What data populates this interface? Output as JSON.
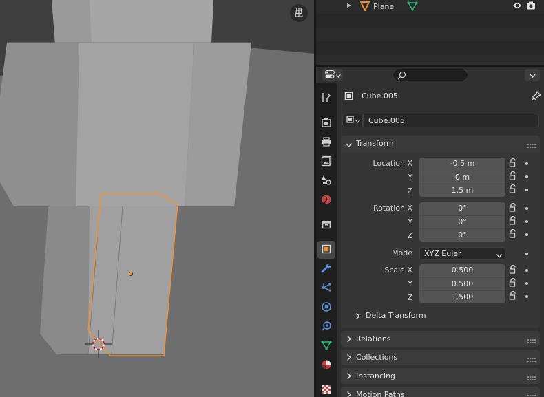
{
  "viewport": {
    "toggle_icon": "grid-perspective-icon"
  },
  "outliner": {
    "item_label": "Plane",
    "item_icon": "object-triangle-icon",
    "data_icon": "mesh-data-icon",
    "visibility_icon": "eye-icon",
    "render_icon": "camera-icon"
  },
  "properties": {
    "object_name": "Cube.005",
    "datablock_name": "Cube.005",
    "transform": {
      "title": "Transform",
      "location_label": "Location X",
      "loc_x": "-0.5 m",
      "loc_y": "0 m",
      "loc_z": "1.5 m",
      "rotation_label": "Rotation X",
      "rot_x": "0°",
      "rot_y": "0°",
      "rot_z": "0°",
      "mode_label": "Mode",
      "mode_value": "XYZ Euler",
      "scale_label": "Scale X",
      "scale_x": "0.500",
      "scale_y": "0.500",
      "scale_z": "1.500",
      "y_label": "Y",
      "z_label": "Z",
      "delta": "Delta Transform"
    },
    "panels": [
      "Relations",
      "Collections",
      "Instancing",
      "Motion Paths"
    ]
  },
  "colors": {
    "accent_orange": "#ff8e22",
    "active_tab": "#494949"
  }
}
